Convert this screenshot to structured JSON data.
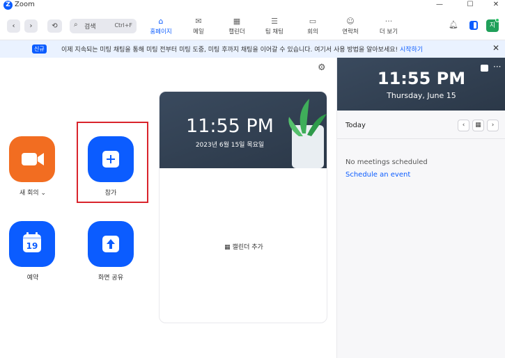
{
  "window": {
    "title": "Zoom",
    "minimize": "—",
    "maximize": "☐",
    "close": "✕"
  },
  "nav": {
    "back": "‹",
    "forward": "›",
    "history": "⟲",
    "search": {
      "placeholder": "검색",
      "shortcut": "Ctrl+F"
    },
    "tabs": [
      {
        "label": "홈페이지",
        "icon": "⌂",
        "active": true
      },
      {
        "label": "메일",
        "icon": "✉",
        "active": false
      },
      {
        "label": "캘린더",
        "icon": "▦",
        "active": false
      },
      {
        "label": "팀 채팅",
        "icon": "☰",
        "active": false
      },
      {
        "label": "회의",
        "icon": "▭",
        "active": false
      },
      {
        "label": "연락처",
        "icon": "☺",
        "active": false
      },
      {
        "label": "더 보기",
        "icon": "···",
        "active": false
      }
    ],
    "avatar_initial": "지"
  },
  "banner": {
    "badge": "신규",
    "text": "이제 지속되는 미팅 채팅을 통해 미팅 전부터 미팅 도중, 미팅 후까지 채팅을 이어갈 수 있습니다. 여기서 사용 방법을 알아보세요!",
    "link": "시작하기"
  },
  "actions": {
    "new_meeting": "새 회의 ⌄",
    "join": "참가",
    "schedule": "예약",
    "share_screen": "화면 공유",
    "calendar_day": "19"
  },
  "card": {
    "time": "11:55 PM",
    "date": "2023년 6월 15일 목요일",
    "add_calendar": "캘린더 추가"
  },
  "right_panel": {
    "time": "11:55 PM",
    "date": "Thursday, June 15",
    "today": "Today",
    "no_meetings": "No meetings scheduled",
    "schedule_link": "Schedule an event"
  },
  "colors": {
    "accent": "#0b5cff",
    "orange": "#f26d21",
    "highlight": "#d9232b"
  }
}
